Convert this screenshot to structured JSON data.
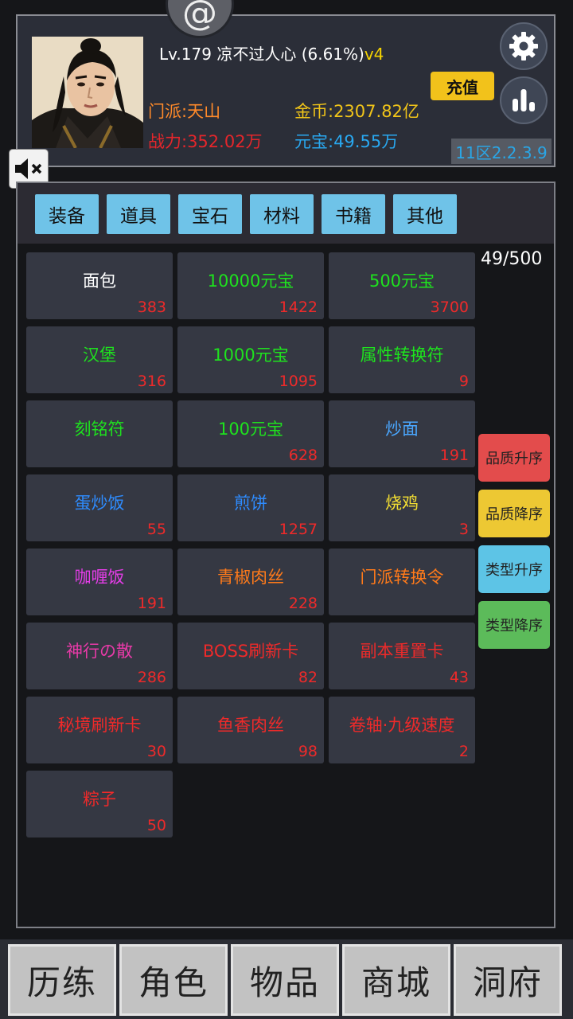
{
  "player": {
    "level_text": "Lv.179",
    "name": "凉不过人心",
    "exp_percent": "(6.61%)",
    "vip": "v4",
    "sect": "门派:天山",
    "gold": "金币:2307.82亿",
    "power": "战力:352.02万",
    "ingot": "元宝:49.55万"
  },
  "header": {
    "top_icon": "@",
    "recharge_label": "充值",
    "server": "11区2.2.3.9",
    "icons": [
      "at-icon",
      "gear-icon",
      "bar-chart-icon",
      "mute-icon"
    ]
  },
  "tabs": [
    {
      "label": "装备"
    },
    {
      "label": "道具"
    },
    {
      "label": "宝石"
    },
    {
      "label": "材料"
    },
    {
      "label": "书籍"
    },
    {
      "label": "其他"
    }
  ],
  "inventory": {
    "capacity": "49/500",
    "items": [
      {
        "name": "面包",
        "count": "383",
        "color": "#ffffff"
      },
      {
        "name": "10000元宝",
        "count": "1422",
        "color": "#1ee21e"
      },
      {
        "name": "500元宝",
        "count": "3700",
        "color": "#1ee21e"
      },
      {
        "name": "汉堡",
        "count": "316",
        "color": "#1ee21e"
      },
      {
        "name": "1000元宝",
        "count": "1095",
        "color": "#1ee21e"
      },
      {
        "name": "属性转换符",
        "count": "9",
        "color": "#1ee21e"
      },
      {
        "name": "刻铭符",
        "count": "",
        "color": "#1ee21e"
      },
      {
        "name": "100元宝",
        "count": "628",
        "color": "#1ee21e"
      },
      {
        "name": "炒面",
        "count": "191",
        "color": "#4aa7ff"
      },
      {
        "name": "蛋炒饭",
        "count": "55",
        "color": "#2e8cff"
      },
      {
        "name": "煎饼",
        "count": "1257",
        "color": "#2e8cff"
      },
      {
        "name": "烧鸡",
        "count": "3",
        "color": "#f5e032"
      },
      {
        "name": "咖喱饭",
        "count": "191",
        "color": "#e53de8"
      },
      {
        "name": "青椒肉丝",
        "count": "228",
        "color": "#ff7a1a"
      },
      {
        "name": "门派转换令",
        "count": "",
        "color": "#ff7a1a"
      },
      {
        "name": "神行の散",
        "count": "286",
        "color": "#e83aa8"
      },
      {
        "name": "BOSS刷新卡",
        "count": "82",
        "color": "#ee2a2a"
      },
      {
        "name": "副本重置卡",
        "count": "43",
        "color": "#ee2a2a"
      },
      {
        "name": "秘境刷新卡",
        "count": "30",
        "color": "#ee2a2a"
      },
      {
        "name": "鱼香肉丝",
        "count": "98",
        "color": "#ee2a2a"
      },
      {
        "name": "卷轴·九级速度",
        "count": "2",
        "color": "#ee2a2a"
      },
      {
        "name": "粽子",
        "count": "50",
        "color": "#ee2a2a"
      }
    ]
  },
  "sort_buttons": [
    {
      "label": "品质升序",
      "color": "#e34c4c"
    },
    {
      "label": "品质降序",
      "color": "#edc833"
    },
    {
      "label": "类型升序",
      "color": "#5dc4e6"
    },
    {
      "label": "类型降序",
      "color": "#5cbb5a"
    }
  ],
  "bottom_nav": [
    {
      "label": "历练"
    },
    {
      "label": "角色"
    },
    {
      "label": "物品"
    },
    {
      "label": "商城"
    },
    {
      "label": "洞府"
    }
  ]
}
